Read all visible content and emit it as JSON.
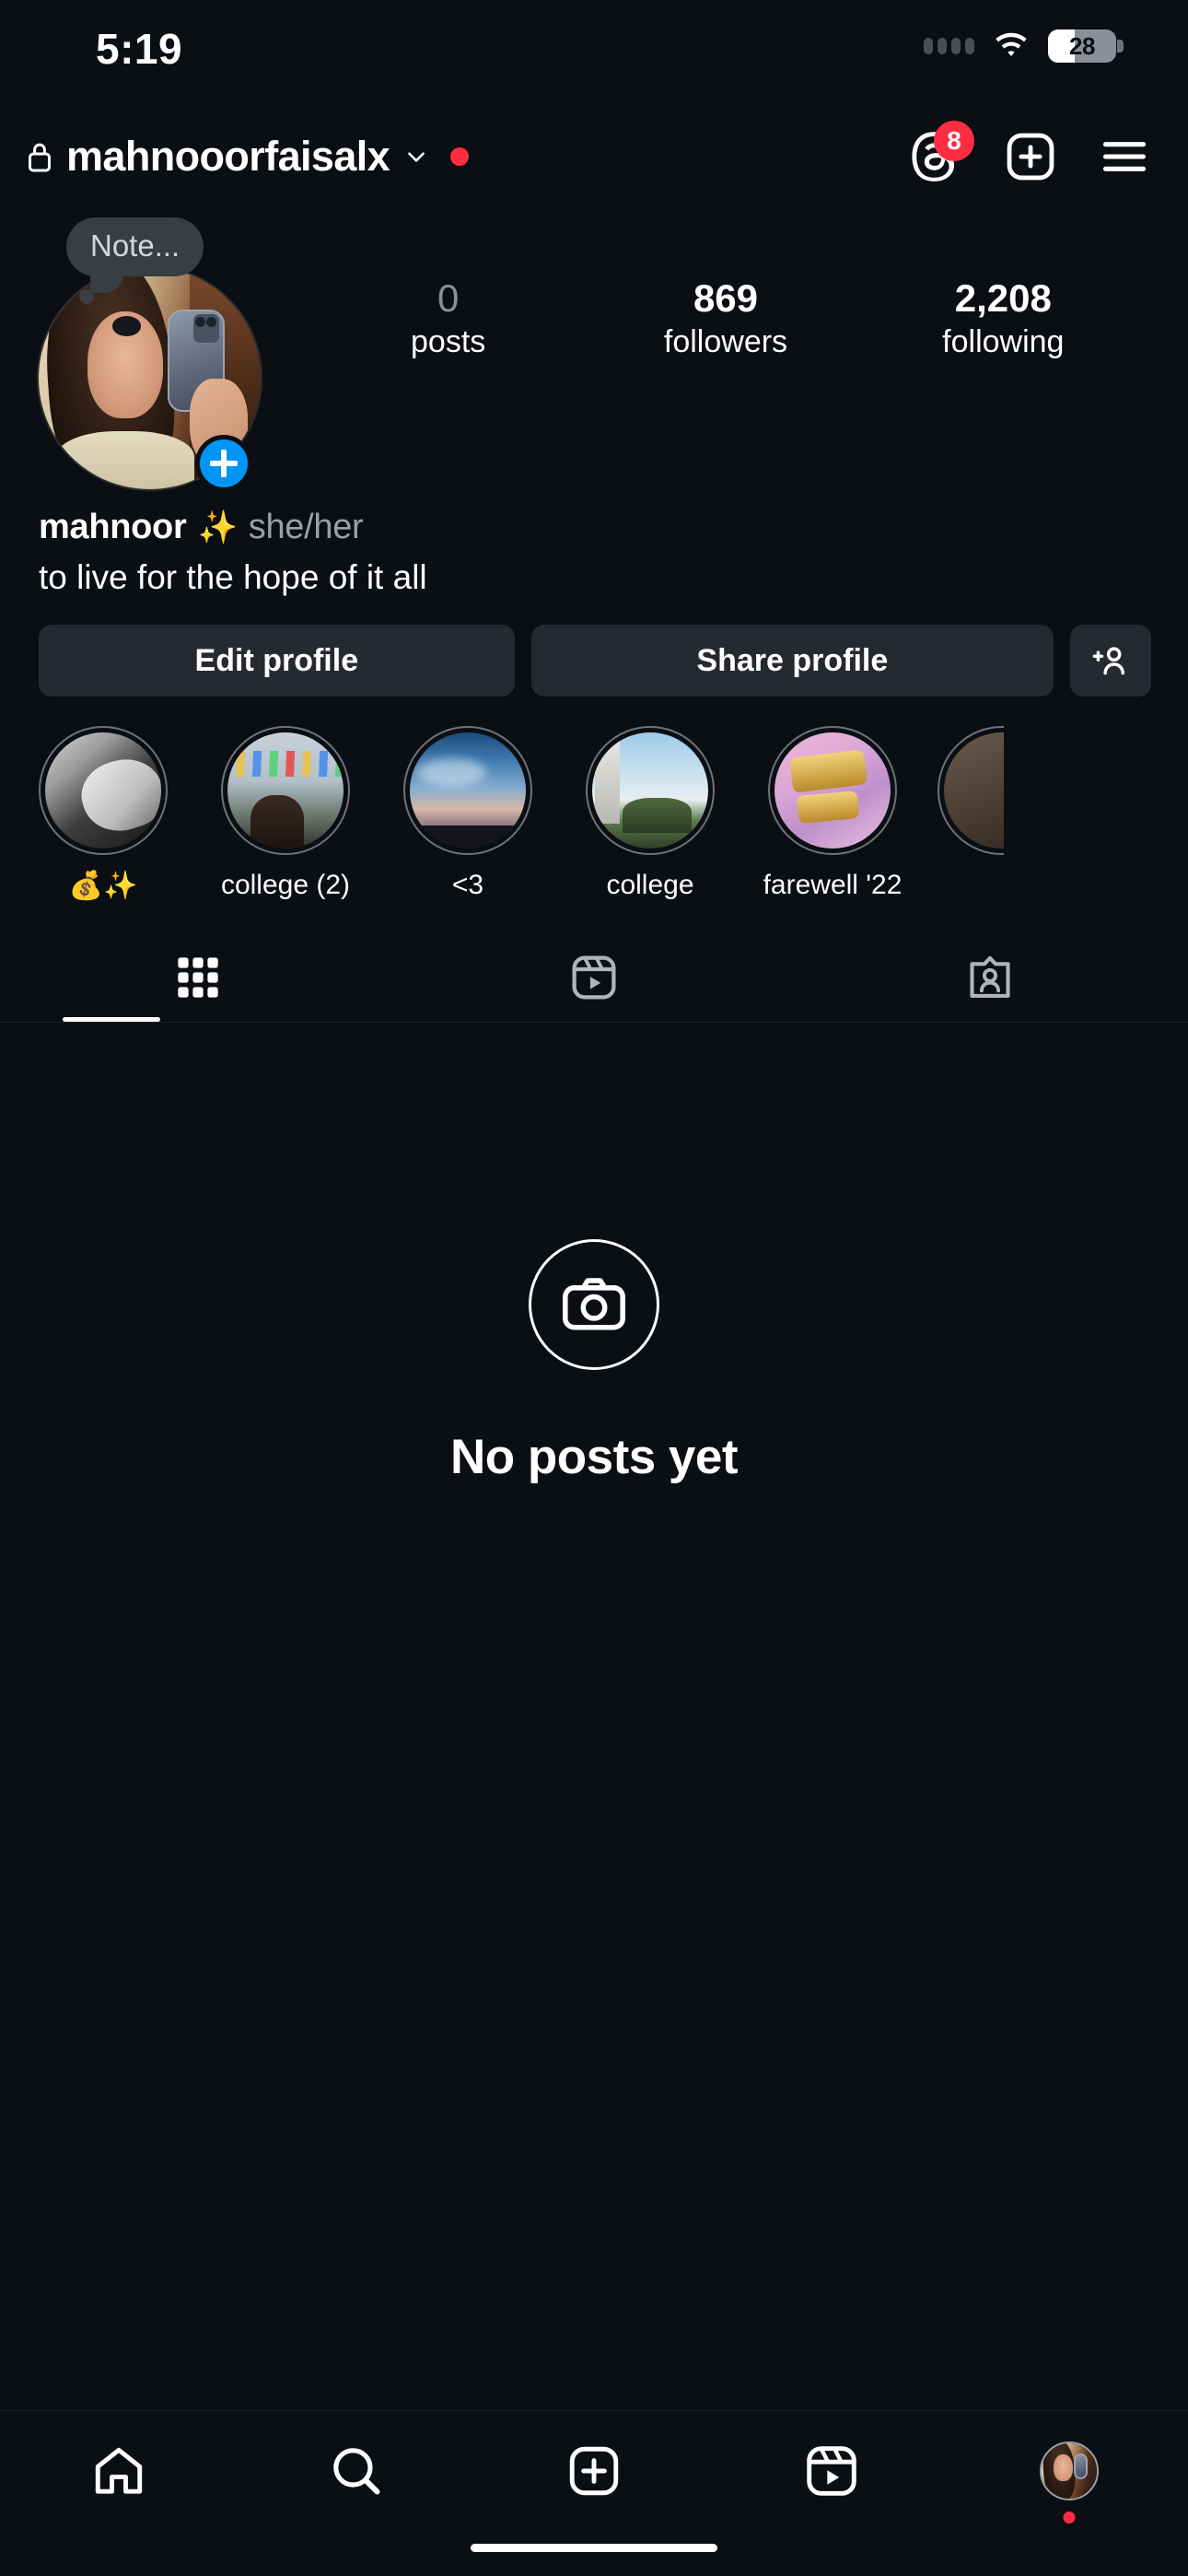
{
  "status_bar": {
    "time": "5:19",
    "battery_level": "28",
    "signal_icon": "signal-dots-icon",
    "wifi_icon": "wifi-icon",
    "battery_icon": "battery-icon"
  },
  "header": {
    "lock_icon": "lock-icon",
    "username": "mahnooorfaisalx",
    "chevron_icon": "chevron-down-icon",
    "status_dot": "red-dot-indicator",
    "threads_icon": "threads-icon",
    "threads_badge": "8",
    "create_icon": "plus-box-icon",
    "menu_icon": "hamburger-menu-icon"
  },
  "profile": {
    "note_label": "Note...",
    "avatar_name": "profile-avatar",
    "add_story_icon": "plus-badge-icon",
    "stats": [
      {
        "value": "0",
        "label": "posts",
        "is_zero": true
      },
      {
        "value": "869",
        "label": "followers",
        "is_zero": false
      },
      {
        "value": "2,208",
        "label": "following",
        "is_zero": false
      }
    ],
    "display_name": "mahnoor",
    "display_name_emoji": "✨",
    "pronouns": "she/her",
    "bio": "to live for the hope of it all"
  },
  "actions": {
    "edit_profile": "Edit profile",
    "share_profile": "Share profile",
    "add_person_icon": "add-person-icon"
  },
  "highlights": [
    {
      "label": "💰✨",
      "image": "img-hands"
    },
    {
      "label": "college (2)",
      "image": "img-fest"
    },
    {
      "label": "<3",
      "image": "img-sky"
    },
    {
      "label": "college",
      "image": "img-campus"
    },
    {
      "label": "farewell '22",
      "image": "img-farewell"
    }
  ],
  "tabs": [
    {
      "name": "grid-tab",
      "icon": "grid-icon",
      "active": true
    },
    {
      "name": "reels-tab",
      "icon": "reels-icon",
      "active": false
    },
    {
      "name": "tagged-tab",
      "icon": "tagged-icon",
      "active": false
    }
  ],
  "empty_state": {
    "icon": "camera-icon",
    "title": "No posts yet"
  },
  "bottom_nav": [
    {
      "name": "home-nav",
      "icon": "home-icon"
    },
    {
      "name": "search-nav",
      "icon": "search-icon"
    },
    {
      "name": "create-nav",
      "icon": "plus-box-icon"
    },
    {
      "name": "reels-nav",
      "icon": "reels-icon"
    },
    {
      "name": "profile-nav",
      "icon": "avatar-icon"
    }
  ],
  "colors": {
    "background": "#0b0e13",
    "accent_blue": "#0095f6",
    "notification_red": "#ff2d42",
    "button_gray": "#262930",
    "muted_text": "#9aa0a8"
  }
}
